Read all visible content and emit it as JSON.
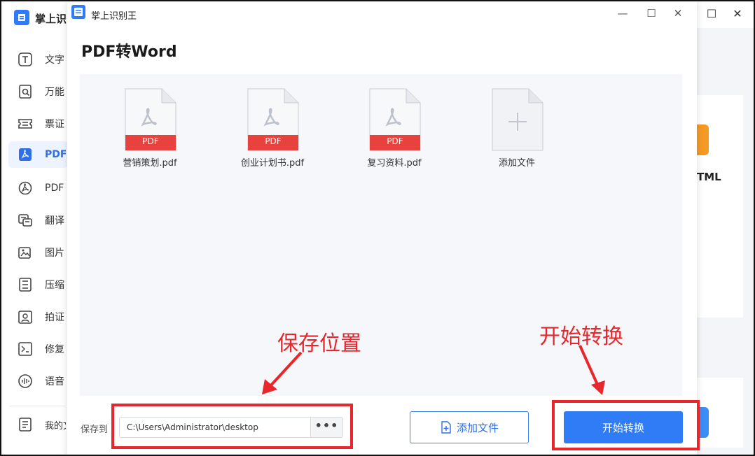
{
  "app": {
    "name": "掌上识"
  },
  "sidebar": {
    "items": [
      {
        "label": "文字",
        "icon": "text-recognition-icon"
      },
      {
        "label": "万能",
        "icon": "universal-scan-icon"
      },
      {
        "label": "票证",
        "icon": "ticket-icon"
      },
      {
        "label": "PDF",
        "icon": "pdf-icon",
        "active": true
      },
      {
        "label": "PDF",
        "icon": "pdf-tools-icon"
      },
      {
        "label": "翻译",
        "icon": "translate-icon"
      },
      {
        "label": "图片",
        "icon": "image-icon"
      },
      {
        "label": "压缩",
        "icon": "compress-icon"
      },
      {
        "label": "拍证",
        "icon": "id-photo-icon"
      },
      {
        "label": "修复",
        "icon": "repair-icon"
      },
      {
        "label": "语音",
        "icon": "voice-icon"
      }
    ],
    "my_docs": "我的文"
  },
  "background": {
    "html_label": "TML"
  },
  "dialog": {
    "title": "掌上识别王",
    "page_title": "PDF转Word",
    "files": [
      {
        "name": "营销策划.pdf",
        "badge": "PDF"
      },
      {
        "name": "创业计划书.pdf",
        "badge": "PDF"
      },
      {
        "name": "复习资料.pdf",
        "badge": "PDF"
      }
    ],
    "add_tile_label": "添加文件",
    "save_label": "保存到",
    "save_path": "C:\\Users\\Administrator\\desktop",
    "browse_label": "•••",
    "add_file_button": "添加文件",
    "start_button": "开始转换"
  },
  "annotations": {
    "save_location": "保存位置",
    "start_convert": "开始转换",
    "color": "#e8262b"
  },
  "colors": {
    "accent": "#2f7cf6",
    "pdf_badge": "#e8423f"
  }
}
